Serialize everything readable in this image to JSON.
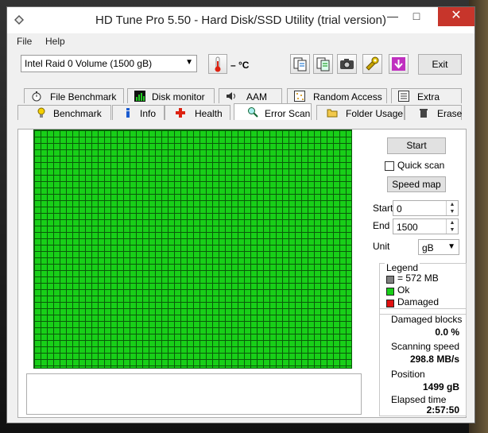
{
  "window": {
    "title": "HD Tune Pro 5.50 - Hard Disk/SSD Utility (trial version)"
  },
  "menu": {
    "file": "File",
    "help": "Help"
  },
  "toolbar": {
    "drive": "Intel   Raid 0 Volume (1500 gB)",
    "temperature": "– °C",
    "exit_label": "Exit"
  },
  "tabs": {
    "row1": [
      "File Benchmark",
      "Disk monitor",
      "AAM",
      "Random Access",
      "Extra tests"
    ],
    "row2": [
      "Benchmark",
      "Info",
      "Health",
      "Error Scan",
      "Folder Usage",
      "Erase"
    ],
    "active": "Error Scan"
  },
  "scan": {
    "start_label": "Start",
    "quick_scan_label": "Quick scan",
    "speed_map_label": "Speed map",
    "start_field_label": "Start",
    "start_value": "0",
    "end_field_label": "End",
    "end_value": "1500",
    "unit_label": "Unit",
    "unit_value": "gB"
  },
  "legend": {
    "title": "Legend",
    "block_size": "= 572 MB",
    "ok": "Ok",
    "damaged": "Damaged",
    "colors": {
      "block": "#808080",
      "ok": "#18cf18",
      "damaged": "#e01010"
    }
  },
  "stats": {
    "damaged_blocks_label": "Damaged blocks",
    "damaged_blocks_value": "0.0 %",
    "scanning_speed_label": "Scanning speed",
    "scanning_speed_value": "298.8 MB/s",
    "position_label": "Position",
    "position_value": "1499 gB",
    "elapsed_label": "Elapsed time",
    "elapsed_value": "2:57:50"
  },
  "icons": {
    "app": "app-diamond-icon",
    "min": "minimize-icon",
    "max": "maximize-icon",
    "close": "close-icon"
  }
}
